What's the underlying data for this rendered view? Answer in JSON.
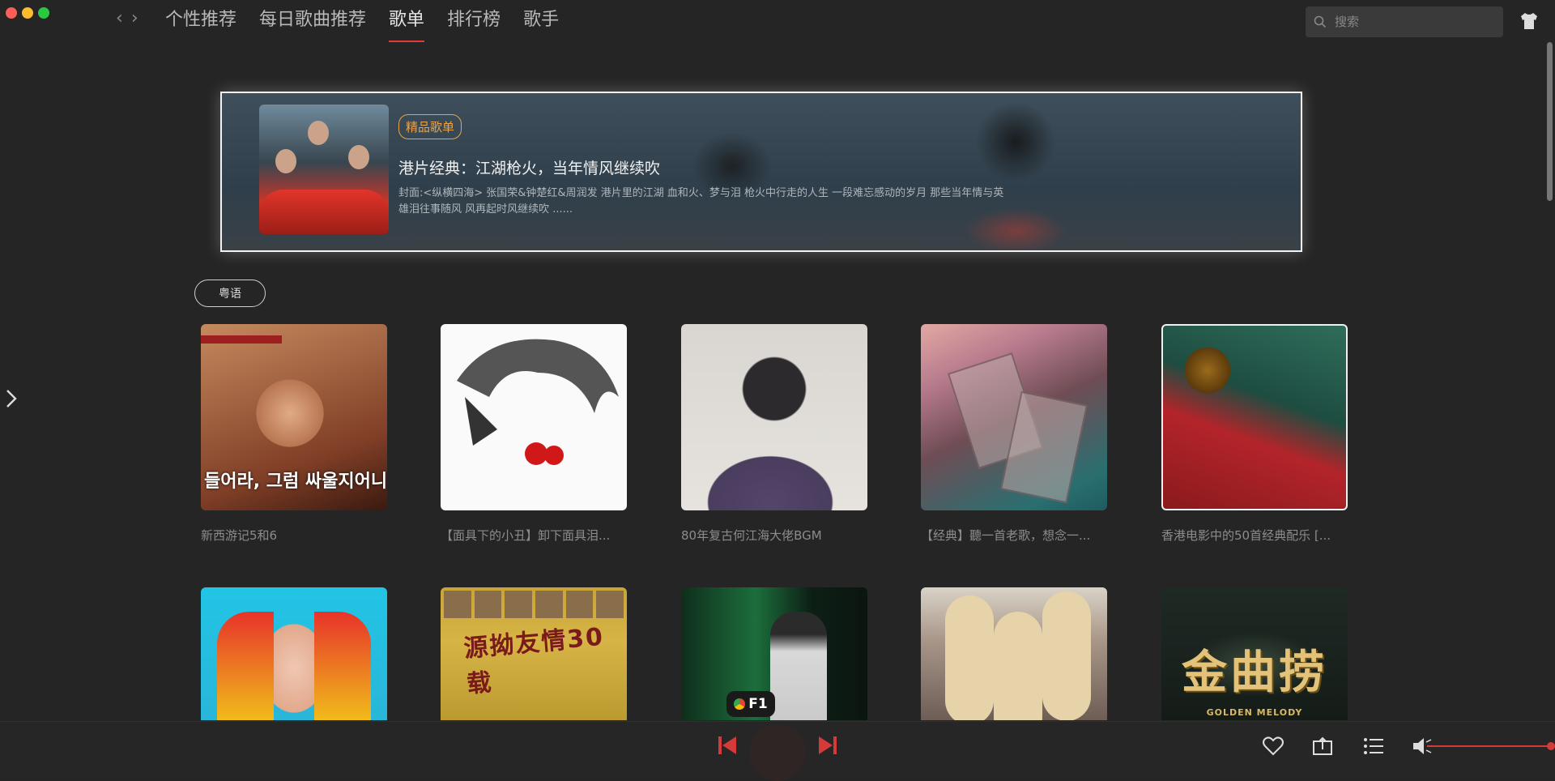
{
  "window": {
    "controls": [
      "close",
      "minimize",
      "maximize"
    ]
  },
  "nav": {
    "back_icon": "chevron-left-icon",
    "forward_icon": "chevron-right-icon",
    "tabs": [
      {
        "label": "个性推荐",
        "active": false
      },
      {
        "label": "每日歌曲推荐",
        "active": false
      },
      {
        "label": "歌单",
        "active": true
      },
      {
        "label": "排行榜",
        "active": false
      },
      {
        "label": "歌手",
        "active": false
      }
    ]
  },
  "search": {
    "placeholder": "搜索",
    "value": ""
  },
  "banner": {
    "badge": "精品歌单",
    "title": "港片经典：江湖枪火，当年情风继续吹",
    "description": "封面:<纵横四海> 张国荣&钟楚红&周润发 港片里的江湖 血和火、梦与泪 枪火中行走的人生 一段难忘感动的岁月 那些当年情与英雄泪往事随风 风再起时风继续吹 ......"
  },
  "filter": {
    "label": "粤语"
  },
  "playlists": [
    {
      "title": "新西游记5和6",
      "cover_text": "들어라, 그럼 싸울지어니"
    },
    {
      "title": "【面具下的小丑】卸下面具泪..."
    },
    {
      "title": "80年复古何江海大佬BGM"
    },
    {
      "title": "【经典】聽一首老歌，想念一..."
    },
    {
      "title": "香港电影中的50首经典配乐 [..."
    },
    {
      "title": ""
    },
    {
      "title": "",
      "cover_text": "源拗友情30载"
    },
    {
      "title": "",
      "cover_text": "F1"
    },
    {
      "title": ""
    },
    {
      "title": "",
      "cover_text": "金曲捞",
      "cover_subtext": "GOLDEN MELODY"
    }
  ],
  "colors": {
    "accent": "#e13a3a",
    "badge": "#e8a34c",
    "background": "#252525"
  },
  "player": {
    "icons": [
      "prev-icon",
      "play-icon",
      "next-icon",
      "heart-icon",
      "share-icon",
      "playlist-icon",
      "volume-icon"
    ]
  }
}
